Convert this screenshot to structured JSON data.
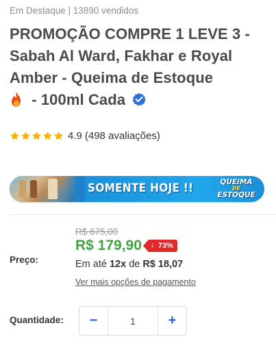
{
  "product": {
    "meta": "Em Destaque | 13890 vendidos",
    "title_main": "PROMOÇÃO COMPRE 1 LEVE 3 - Sabah Al Ward, Fakhar e Royal Amber - Queima de Estoque",
    "title_suffix": " - 100ml Cada",
    "icons": [
      "fire-icon",
      "verified-check-icon"
    ]
  },
  "rating": {
    "stars": 5,
    "value": "4.9",
    "count_text": "(498 avaliações)"
  },
  "banner": {
    "text": "SOMENTE HOJE !!",
    "badge_line1": "QUEIMA",
    "badge_line2": "DE",
    "badge_line3": "ESTOQUE"
  },
  "pricing": {
    "label": "Preço:",
    "old_price": "R$ 675,00",
    "price": "R$ 179,90",
    "discount": "73%",
    "installment_prefix": "Em até ",
    "installment_count": "12x",
    "installment_mid": " de ",
    "installment_value": "R$ 18,07",
    "payment_link": "Ver mais opções de pagamento"
  },
  "quantity": {
    "label": "Quantidade:",
    "value": "1",
    "minus": "−",
    "plus": "+"
  },
  "colors": {
    "price_green": "#3fa33f",
    "discount_red": "#e02a2a",
    "accent_blue": "#2a5fd1",
    "star_gold": "#f5b301"
  }
}
